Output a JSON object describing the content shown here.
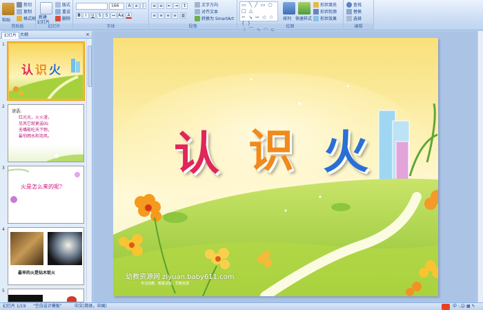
{
  "ribbon": {
    "clipboard": {
      "paste": "粘贴",
      "cut": "剪切",
      "copy": "复制",
      "format_painter": "格式刷",
      "label": "剪贴板"
    },
    "slides": {
      "new_slide": "新建",
      "new_slide_2": "幻灯片",
      "layout": "版式",
      "reset": "重设",
      "delete": "删除",
      "label": "幻灯片"
    },
    "font": {
      "size": "166",
      "label": "字体"
    },
    "paragraph": {
      "text_direction": "文字方向",
      "align_text": "对齐文本",
      "smartart": "转换为 SmartArt",
      "label": "段落"
    },
    "drawing": {
      "arrange": "排列",
      "quick_styles": "快速样式",
      "shape_fill": "形状填充",
      "shape_outline": "形状轮廓",
      "shape_effects": "形状效果",
      "label": "绘图"
    },
    "editing": {
      "find": "查找",
      "replace": "替换",
      "select": "选择",
      "label": "编辑"
    }
  },
  "panel": {
    "tab_slides": "幻灯片",
    "tab_outline": "大纲",
    "close": "×"
  },
  "thumbnails": [
    {
      "num": "1",
      "title": "认识火"
    },
    {
      "num": "2",
      "lines": [
        "谜语:",
        "红光光，火火漫，",
        "见风它就更逞凶;",
        "无嘴能吃天下物，",
        "最怕雨水和泡风。"
      ]
    },
    {
      "num": "3",
      "text": "火是怎么来的呢？"
    },
    {
      "num": "4",
      "caption": "最早的火是钻木取火"
    },
    {
      "num": "5"
    }
  ],
  "slide": {
    "title_chars": [
      "认",
      "识",
      "火"
    ],
    "title_colors": [
      "#e0265a",
      "#f08a1c",
      "#2a6fd6"
    ],
    "watermark": "幼教资源网 ziyuan.baby611.com",
    "watermark_sub": "专注幼教、教案试题、早教资源"
  },
  "status": {
    "slide_info": "幻灯片 1/19",
    "theme": "\"空白设计模板\"",
    "language": "中文(简体，中国)"
  }
}
